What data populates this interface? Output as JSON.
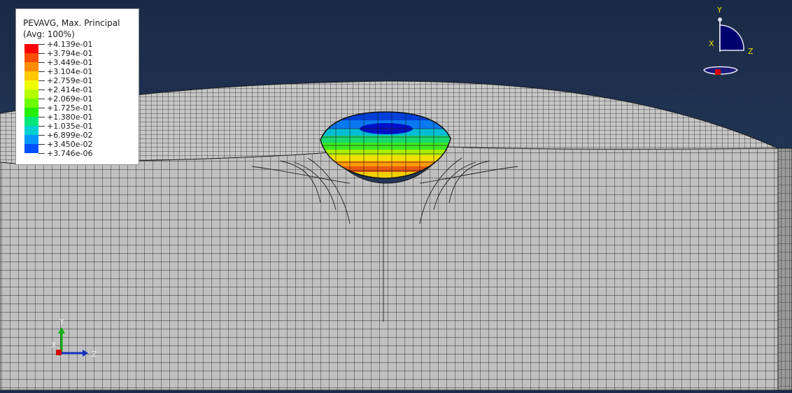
{
  "legend": {
    "title_line1": "PEVAVG, Max. Principal",
    "title_line2": "(Avg: 100%)",
    "values": [
      "+4.139e-01",
      "+3.794e-01",
      "+3.449e-01",
      "+3.104e-01",
      "+2.759e-01",
      "+2.414e-01",
      "+2.069e-01",
      "+1.725e-01",
      "+1.380e-01",
      "+1.035e-01",
      "+6.899e-02",
      "+3.450e-02",
      "+3.746e-06"
    ],
    "colors": [
      "#ff0000",
      "#ff4d00",
      "#ff8c00",
      "#ffc800",
      "#f0ff00",
      "#b4ff00",
      "#6cff00",
      "#22f000",
      "#00e67a",
      "#00d0d0",
      "#0096ff",
      "#0050ff",
      "#0000ff"
    ]
  },
  "triad_top": {
    "y_label": "Y",
    "x_label": "X",
    "z_label": "Z"
  },
  "triad_bottom": {
    "y_label": "Y",
    "x_label": "X",
    "z_label": "Z"
  },
  "colors": {
    "background_top": "#1b2b47",
    "background_bottom": "#2b4466",
    "mesh_face": "#bdbdbd",
    "mesh_line": "#2a2a2a",
    "triad_fill": "#00006e"
  }
}
